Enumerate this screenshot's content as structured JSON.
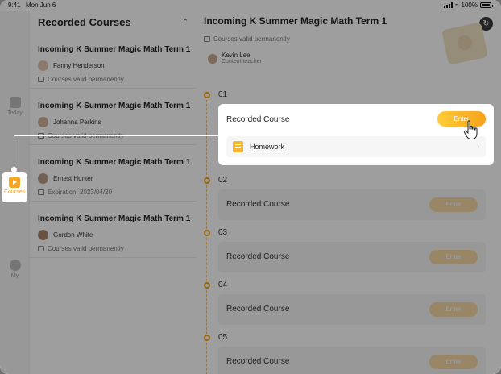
{
  "status": {
    "time": "9:41",
    "date": "Mon Jun 6",
    "battery": "100%"
  },
  "rail": {
    "today_label": "Today",
    "courses_label": "Courses",
    "my_label": "My"
  },
  "list": {
    "title": "Recorded Courses",
    "items": [
      {
        "title": "Incoming K Summer Magic Math Term 1",
        "teacher": "Fanny Henderson",
        "meta": "Courses valid permanently"
      },
      {
        "title": "Incoming K Summer Magic Math Term 1",
        "teacher": "Johanna Perkins",
        "meta": "Courses valid permanently"
      },
      {
        "title": "Incoming K Summer Magic Math Term 1",
        "teacher": "Ernest Hunter",
        "meta": "Expiration: 2023/04/20"
      },
      {
        "title": "Incoming K Summer Magic Math Term 1",
        "teacher": "Gordon White",
        "meta": "Courses valid permanently"
      }
    ]
  },
  "detail": {
    "title": "Incoming K Summer Magic Math Term 1",
    "valid": "Courses valid permanently",
    "teacher_name": "Kevin Lee",
    "teacher_role": "Content teacher",
    "sections": [
      {
        "num": "01",
        "label": "Recorded Course",
        "enter": "Enter",
        "homework": "Homework"
      },
      {
        "num": "02",
        "label": "Recorded Course",
        "enter": "Enter"
      },
      {
        "num": "03",
        "label": "Recorded Course",
        "enter": "Enter"
      },
      {
        "num": "04",
        "label": "Recorded Course",
        "enter": "Enter"
      },
      {
        "num": "05",
        "label": "Recorded Course",
        "enter": "Enter"
      }
    ]
  },
  "colors": {
    "accent": "#f5a623",
    "overlay": "rgba(0,0,0,0.38)"
  }
}
